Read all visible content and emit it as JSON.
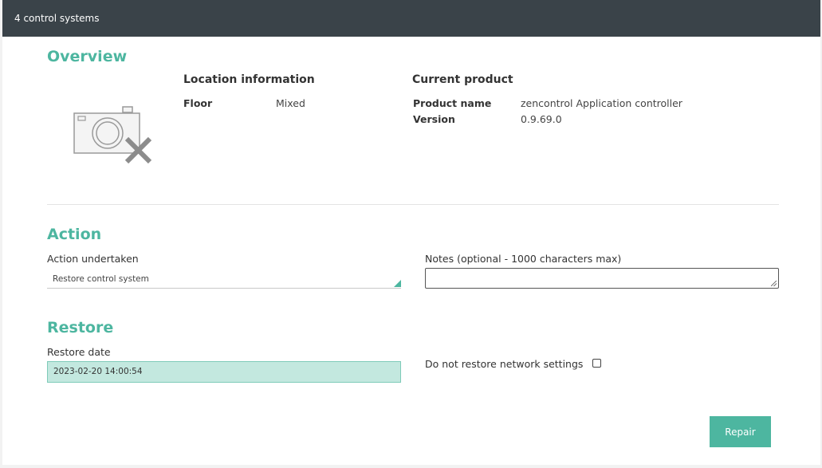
{
  "window": {
    "title": "4 control systems"
  },
  "overview": {
    "title": "Overview",
    "image_icon": "no-photo-camera-icon",
    "location": {
      "heading": "Location information",
      "floor_label": "Floor",
      "floor_value": "Mixed"
    },
    "product": {
      "heading": "Current product",
      "name_label": "Product name",
      "name_value": "zencontrol Application controller",
      "version_label": "Version",
      "version_value": "0.9.69.0"
    }
  },
  "action": {
    "title": "Action",
    "undertaken_label": "Action undertaken",
    "undertaken_value": "Restore control system",
    "notes_label": "Notes (optional - 1000 characters max)",
    "notes_value": ""
  },
  "restore": {
    "title": "Restore",
    "date_label": "Restore date",
    "date_value": "2023-02-20 14:00:54",
    "network_label": "Do not restore network settings",
    "network_checked": false
  },
  "buttons": {
    "repair_label": "Repair"
  },
  "colors": {
    "accent": "#4db6a0",
    "titlebar": "#3a4349",
    "date_field_bg": "#c3e8df"
  }
}
